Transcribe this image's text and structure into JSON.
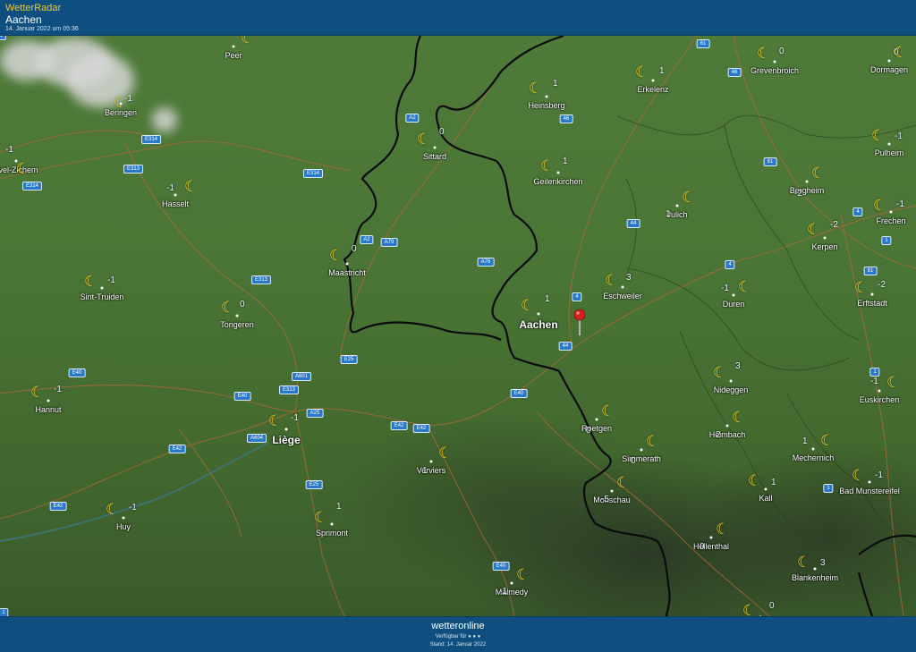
{
  "header": {
    "app_title": "WetterRadar",
    "place": "Aachen",
    "timestamp": "14. Januar 2022 um 05:36"
  },
  "footer": {
    "brand": "wetteronline",
    "available_text": "Verfügbar für ● ● ●",
    "stand_text": "Stand: 14. Januar 2022"
  },
  "colors": {
    "header_bg": "#0f4f7f",
    "moon": "#f6d422",
    "road_badge": "#2a78c8",
    "pin": "#d62020"
  },
  "icons": {
    "weather": "crescent-moon-icon",
    "location": "map-pin-icon"
  },
  "cities": [
    {
      "name": "Peer",
      "temp": ""
    },
    {
      "name": "Beringen",
      "temp": "-1"
    },
    {
      "name": "avel-Zichem",
      "temp": "-1"
    },
    {
      "name": "Hasselt",
      "temp": "-1"
    },
    {
      "name": "Sint-Truiden",
      "temp": "-1"
    },
    {
      "name": "Tongeren",
      "temp": "0"
    },
    {
      "name": "Hannut",
      "temp": "-1"
    },
    {
      "name": "Huy",
      "temp": "-1"
    },
    {
      "name": "Liège",
      "temp": "-1"
    },
    {
      "name": "Sprimont",
      "temp": "1"
    },
    {
      "name": "Verviers",
      "temp": "1"
    },
    {
      "name": "Malmedy",
      "temp": "-1"
    },
    {
      "name": "Maastricht",
      "temp": "0"
    },
    {
      "name": "Sittard",
      "temp": "0"
    },
    {
      "name": "Heinsberg",
      "temp": "1"
    },
    {
      "name": "Geilenkirchen",
      "temp": "1"
    },
    {
      "name": "Erkelenz",
      "temp": "1"
    },
    {
      "name": "Aachen",
      "temp": "1"
    },
    {
      "name": "Eschweiler",
      "temp": "3"
    },
    {
      "name": "Julich",
      "temp": "1"
    },
    {
      "name": "Roetgen",
      "temp": "0"
    },
    {
      "name": "Simmerath",
      "temp": "0"
    },
    {
      "name": "Monschau",
      "temp": "-5"
    },
    {
      "name": "Hellenthal",
      "temp": "0"
    },
    {
      "name": "Heimbach",
      "temp": "2"
    },
    {
      "name": "Nideggen",
      "temp": "3"
    },
    {
      "name": "Duren",
      "temp": "-1"
    },
    {
      "name": "Kerpen",
      "temp": "-2"
    },
    {
      "name": "Bergheim",
      "temp": "-2"
    },
    {
      "name": "Grevenbroich",
      "temp": "0"
    },
    {
      "name": "Dormagen",
      "temp": "0"
    },
    {
      "name": "Pulheim",
      "temp": "-1"
    },
    {
      "name": "Frechen",
      "temp": "-1"
    },
    {
      "name": "Erftstadt",
      "temp": "-2"
    },
    {
      "name": "Euskirchen",
      "temp": "-1"
    },
    {
      "name": "Mechernich",
      "temp": "1"
    },
    {
      "name": "Kall",
      "temp": "1"
    },
    {
      "name": "Bad Munstereifel",
      "temp": "-1"
    },
    {
      "name": "Blankenheim",
      "temp": "3"
    },
    {
      "name": "",
      "temp": "0"
    }
  ],
  "roads": [
    "E314",
    "E313",
    "E314",
    "E314",
    "A2",
    "A2",
    "A79",
    "A76",
    "E313",
    "A601",
    "E313",
    "E40",
    "E40",
    "E25",
    "A25",
    "A604",
    "E42",
    "E25",
    "E40",
    "E42",
    "E42",
    "E42",
    "E40",
    "44",
    "4",
    "44",
    "46",
    "46",
    "61",
    "61",
    "44",
    "4",
    "4",
    "1",
    "61",
    "1",
    "1",
    "1",
    "11"
  ]
}
